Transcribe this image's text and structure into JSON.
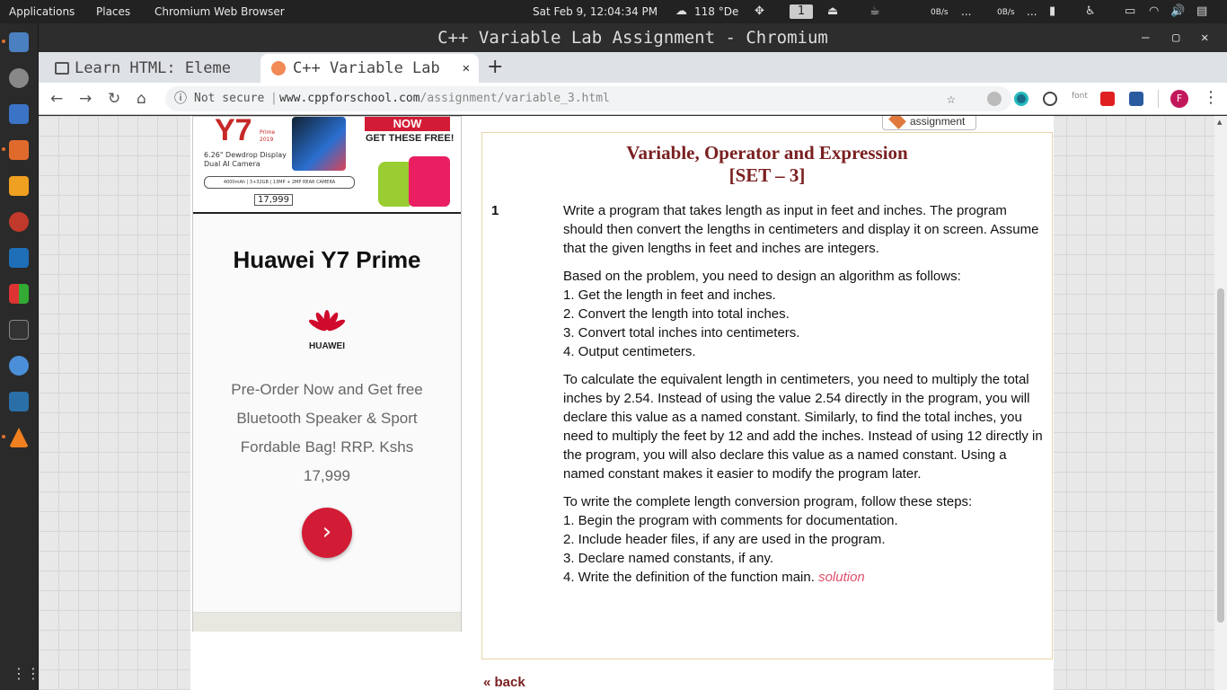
{
  "system_bar": {
    "applications": "Applications",
    "places": "Places",
    "browser_menu": "Chromium Web Browser",
    "clock": "Sat Feb 9, 12:04:34 PM",
    "weather": "118 °De",
    "workspace": "1",
    "net_down": "0B/s",
    "net_up": "0B/s",
    "ellipsis_1": "...",
    "ellipsis_2": "..."
  },
  "window": {
    "title": "C++ Variable Lab Assignment - Chromium",
    "minimize": "–",
    "maximize": "▢",
    "close": "✕"
  },
  "tabs": [
    {
      "label": "Learn HTML: Eleme"
    },
    {
      "label": "C++ Variable Lab",
      "close": "✕"
    }
  ],
  "new_tab": "+",
  "address_bar": {
    "security": "Not secure",
    "url_domain": "www.cppforschool.com",
    "url_path": "/assignment/variable_3.html",
    "ext_font": "font",
    "profile": "F"
  },
  "ad": {
    "banner_now": "NOW",
    "banner_free": "GET THESE FREE!",
    "banner_model": "Y7",
    "banner_prime": "Prime\n2019",
    "banner_display": "6.26\" Dewdrop Display\nDual AI Camera",
    "banner_specs": "4000mAh | 3+32GB | 13MP + 2MP REAR CAMERA",
    "banner_price": "17,999",
    "title": "Huawei Y7 Prime",
    "brand": "HUAWEI",
    "text": "Pre-Order Now and Get free Bluetooth Speaker & Sport Fordable Bag! RRP. Kshs 17,999",
    "cta": "›"
  },
  "assignment_logo": "assignment",
  "content": {
    "title_line1": "Variable, Operator and Expression",
    "title_line2": "[SET – 3]",
    "question_number": "1",
    "para1": "Write a program that takes length as input in feet and inches. The program should then convert the lengths in centimeters and display it on screen. Assume that the given lengths in feet and inches are integers.",
    "algo_intro": "Based on the problem, you need to design an algorithm as follows:",
    "algo_steps": [
      "1. Get the length in feet and inches.",
      "2. Convert the length into total inches.",
      "3. Convert total inches into centimeters.",
      "4. Output centimeters."
    ],
    "para3": "To calculate the equivalent length in centimeters, you need to multiply the total inches by 2.54. Instead of using the value 2.54 directly in the program, you will declare this value as a named constant. Similarly, to find the total inches, you need to multiply the feet by 12 and add the inches. Instead of using 12 directly in the program, you will also declare this value as a named constant. Using a named constant makes it easier to modify the program later.",
    "steps_intro": "To write the complete length conversion program, follow these steps:",
    "steps": [
      "1. Begin the program with comments for documentation.",
      "2. Include header files, if any are used in the program.",
      "3. Declare named constants, if any.",
      "4. Write the definition of the function main."
    ],
    "solution_link": "solution"
  },
  "back_link": "« back"
}
